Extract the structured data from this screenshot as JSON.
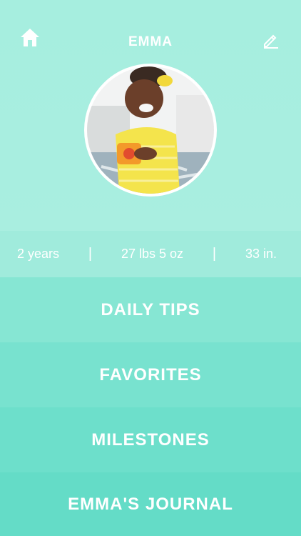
{
  "header": {
    "title": "EMMA",
    "home_icon": "home-icon",
    "edit_icon": "pencil-icon",
    "photo": "profile-photo"
  },
  "stats": {
    "age": "2 years",
    "separator": "|",
    "weight": "27 lbs 5 oz",
    "height": "33 in."
  },
  "menu": [
    {
      "label": "DAILY TIPS"
    },
    {
      "label": "FAVORITES"
    },
    {
      "label": "MILESTONES"
    },
    {
      "label": "EMMA'S JOURNAL"
    }
  ],
  "colors": {
    "header_bg": "#a6eedf",
    "stats_bg": "#a0ebdc",
    "menu_1": "#86e6d3",
    "menu_2": "#78e2cf",
    "menu_3": "#6ddfcb",
    "menu_4": "#64dcc7",
    "text": "#ffffff"
  }
}
